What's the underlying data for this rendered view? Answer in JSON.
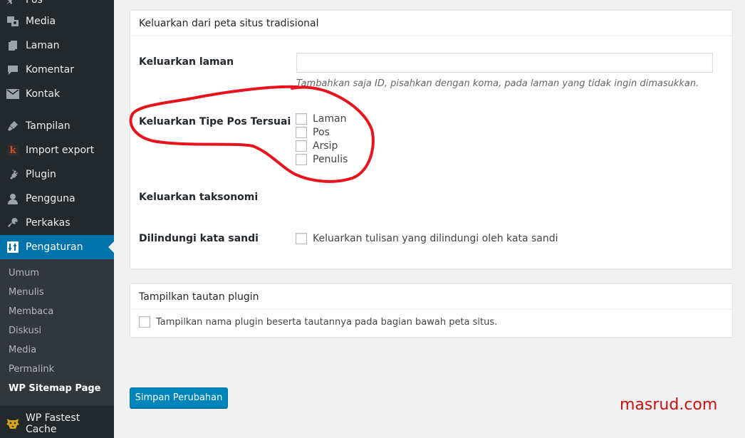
{
  "sidebar": {
    "top_partial_label": "Pos",
    "items": [
      {
        "label": "Media",
        "icon": "media-icon"
      },
      {
        "label": "Laman",
        "icon": "pages-icon"
      },
      {
        "label": "Komentar",
        "icon": "comments-icon"
      },
      {
        "label": "Kontak",
        "icon": "envelope-icon"
      },
      {
        "label": "Tampilan",
        "icon": "appearance-icon"
      },
      {
        "label": "Import export",
        "icon": "import-export-icon"
      },
      {
        "label": "Plugin",
        "icon": "plugin-icon"
      },
      {
        "label": "Pengguna",
        "icon": "users-icon"
      },
      {
        "label": "Perkakas",
        "icon": "tools-icon"
      },
      {
        "label": "Pengaturan",
        "icon": "settings-icon"
      }
    ],
    "submenu": [
      "Umum",
      "Menulis",
      "Membaca",
      "Diskusi",
      "Media",
      "Permalink",
      "WP Sitemap Page"
    ],
    "bottom_item": {
      "label": "WP Fastest Cache",
      "icon": "cheetah-icon"
    }
  },
  "panel_exclude": {
    "title": "Keluarkan dari peta situs tradisional",
    "exclude_pages_label": "Keluarkan laman",
    "exclude_pages_value": "",
    "exclude_pages_hint": "Tambahkan saja ID, pisahkan dengan koma, pada laman yang tidak ingin dimasukkan.",
    "custom_post_types_label": "Keluarkan Tipe Pos Tersuai",
    "post_types": [
      "Laman",
      "Pos",
      "Arsip",
      "Penulis"
    ],
    "taxonomy_label": "Keluarkan taksonomi",
    "password_label": "Dilindungi kata sandi",
    "password_option": "Keluarkan tulisan yang dilindungi oleh kata sandi"
  },
  "panel_plugin_link": {
    "title": "Tampilkan tautan plugin",
    "option": "Tampilkan nama plugin beserta tautannya pada bagian bawah peta situs."
  },
  "save_button": "Simpan Perubahan",
  "watermark": "masrud.com",
  "colors": {
    "sidebar": "#23282d",
    "active": "#0073aa",
    "button": "#0085ba",
    "annotation": "#e8141c"
  }
}
